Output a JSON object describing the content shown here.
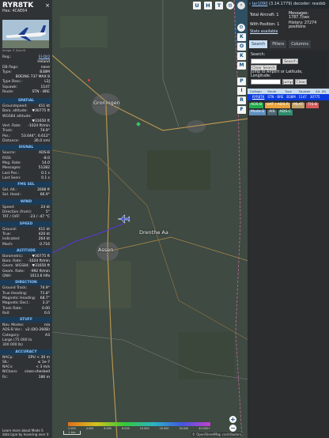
{
  "left": {
    "callsign": "RYR8TK",
    "hex_label": "Hex: 4CAE64",
    "close_icon": "×",
    "photo_credit": "Image © BjornD",
    "info_rows": [
      {
        "k": "Reg.:",
        "v": "EI-DJQ",
        "link": true
      },
      {
        "k": "",
        "v": "Ireland"
      },
      {
        "k": "DB flags:",
        "v": "none"
      },
      {
        "k": "Type:",
        "v": "B38M"
      },
      {
        "k": "",
        "v": "BOEING 737 MAX 8"
      },
      {
        "k": "Type Desc.:",
        "v": "L2J"
      },
      {
        "k": "Squawk:",
        "v": "1147"
      },
      {
        "k": "Route:",
        "v": "STN - BRE"
      }
    ],
    "sections": [
      {
        "title": "SPATIAL",
        "rows": [
          {
            "k": "Groundspeed:",
            "v": "411 kt"
          },
          {
            "k": "Baro. altitude:",
            "v": "▼30775 ft"
          },
          {
            "k": "WGS84 altitude:",
            "v": ""
          },
          {
            "k": "",
            "v": "▼31650 ft"
          },
          {
            "k": "Vert. Rate:",
            "v": "-1024 ft/min"
          },
          {
            "k": "Track:",
            "v": "74.9°"
          },
          {
            "k": "Pos.:",
            "v": "53.044°, 6.612°"
          },
          {
            "k": "Distance:",
            "v": "26.0 nmi"
          }
        ]
      },
      {
        "title": "SIGNAL",
        "rows": [
          {
            "k": "Source:",
            "v": "ADS-B"
          },
          {
            "k": "RSSI:",
            "v": "-8.0"
          },
          {
            "k": "Msg. Rate:",
            "v": "14.0"
          },
          {
            "k": "Messages:",
            "v": "51282"
          },
          {
            "k": "Last Pos.:",
            "v": "0.1 s"
          },
          {
            "k": "Last Seen:",
            "v": "0.1 s"
          }
        ]
      },
      {
        "title": "FMS SEL",
        "rows": [
          {
            "k": "Sel. Alt.:",
            "v": "3008 ft"
          },
          {
            "k": "Sel. Head.:",
            "v": "66.9°"
          }
        ]
      },
      {
        "title": "WIND",
        "rows": [
          {
            "k": "Speed:",
            "v": "24 kt"
          },
          {
            "k": "Direction (from):",
            "v": "5°"
          },
          {
            "k": "TAT / OAT:",
            "v": "-23 / -47 °C"
          }
        ]
      },
      {
        "title": "SPEED",
        "rows": [
          {
            "k": "Ground:",
            "v": "411 kt"
          },
          {
            "k": "True:",
            "v": "420 kt"
          },
          {
            "k": "Indicated:",
            "v": "264 kt"
          },
          {
            "k": "Mach:",
            "v": "0.716"
          }
        ]
      },
      {
        "title": "ALTITUDE",
        "rows": [
          {
            "k": "Barometric:",
            "v": "▼30775 ft"
          },
          {
            "k": "Baro. Rate:",
            "v": "-1024 ft/min"
          },
          {
            "k": "Geom. WGS84:",
            "v": "▼31650 ft"
          },
          {
            "k": "Geom. Rate:",
            "v": "-992 ft/min"
          },
          {
            "k": "QNH:",
            "v": "1013.6 hPa"
          }
        ]
      },
      {
        "title": "DIRECTION",
        "rows": [
          {
            "k": "Ground Track:",
            "v": "74.9°"
          },
          {
            "k": "True Heading:",
            "v": "71.8°"
          },
          {
            "k": "Magnetic Heading:",
            "v": "68.7°"
          },
          {
            "k": "Magnetic Decl.:",
            "v": "3.3°"
          },
          {
            "k": "Track Rate:",
            "v": "0.00"
          },
          {
            "k": "Roll:",
            "v": "0.0"
          }
        ]
      },
      {
        "title": "STUFF",
        "rows": [
          {
            "k": "Nav. Modes:",
            "v": "n/a"
          },
          {
            "k": "ADS-B Ver.:",
            "v": "v2 (DO-260B)"
          },
          {
            "k": "Category:",
            "v": "A3"
          },
          {
            "k": "Large (75 000 to",
            "v": ""
          },
          {
            "k": "300 000 lb)",
            "v": ""
          }
        ]
      },
      {
        "title": "ACCURACY",
        "rows": [
          {
            "k": "NACp:",
            "v": "EPU < 30 m"
          },
          {
            "k": "SIL:",
            "v": "≤ 1e-7"
          },
          {
            "k": "NACv:",
            "v": "< 3 m/s"
          },
          {
            "k": "NICbaro:",
            "v": "cross-checked"
          },
          {
            "k": "Rc:",
            "v": "186 m"
          }
        ]
      }
    ],
    "footer": "Learn more about Mode S data type by hovering over it"
  },
  "map": {
    "top_buttons": [
      "U",
      "H",
      "T"
    ],
    "side_buttons": [
      "K",
      "O",
      "K",
      "M",
      "P",
      "I",
      "R",
      "F"
    ],
    "city_labels": [
      "Groningen",
      "Assen",
      "Drenthe Aa"
    ],
    "scale_label": "1 km",
    "attribution": "© OpenStreetMap contributors",
    "zoom_in": "+",
    "zoom_out": "−",
    "color_scale_ticks": [
      "2.000",
      "4.000",
      "6.000",
      "8.000",
      "10.000",
      "20.000",
      "30.000",
      "40.000+"
    ]
  },
  "right": {
    "version_link": "tar1090",
    "version_text": "(3.14.1779) decoder: readsb",
    "total_label": "Total Aircraft: 1",
    "with_pos_label": "With Position: 1",
    "stats_label": "Stats available",
    "messages_label": "Messages:",
    "messages_rate": "1787.7/sec",
    "history_label": "History: 27274",
    "history_unit": "positions",
    "tabs": [
      "Search",
      "Filters",
      "Columns"
    ],
    "search_label": "Search:",
    "search_button": "Search",
    "clear_search_button": "Clear Search",
    "jump_label": "Jump to Airport or Latitude,",
    "jump_label2": "Longitude:",
    "jump_button": "Jump",
    "clear_button": "Clear",
    "table_headers": [
      "Callsign",
      "Route",
      "Type",
      "Squawk",
      "Alt. (ft)"
    ],
    "table_row": [
      "RYR8TK",
      "STN - BRE",
      "B38M",
      "1147",
      "30775"
    ],
    "legend": [
      {
        "label": "ADS-B",
        "color": "#23a94a"
      },
      {
        "label": "UAT / ADS-R",
        "color": "#e8a23b"
      },
      {
        "label": "MLAT",
        "color": "#c0a16b"
      },
      {
        "label": "TIS-B",
        "color": "#d35c5c"
      },
      {
        "label": "Mode-S",
        "color": "#5e8fbf"
      },
      {
        "label": "AIS",
        "color": "#4c6672"
      },
      {
        "label": "ADS-C",
        "color": "#2f8c6b"
      }
    ]
  }
}
